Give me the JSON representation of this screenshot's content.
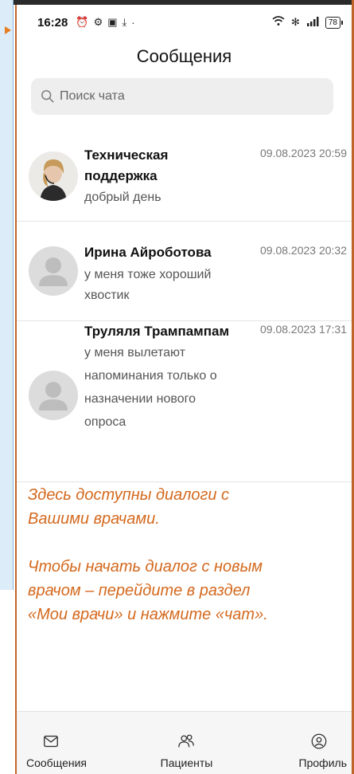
{
  "status_bar": {
    "time": "16:28",
    "battery": "78"
  },
  "header": {
    "title": "Сообщения"
  },
  "search": {
    "placeholder": "Поиск чата"
  },
  "chats": [
    {
      "name_line1": "Техническая",
      "name_line2": "поддержка",
      "time": "09.08.2023 20:59",
      "message": "добрый день"
    },
    {
      "name": "Ирина Айроботова",
      "time": "09.08.2023 20:32",
      "message_line1": "у меня тоже хороший",
      "message_line2": "хвостик"
    },
    {
      "name": "Труляля Трампампам",
      "time": "09.08.2023 17:31",
      "message_line1": "у меня вылетают",
      "message_line2": "напоминания только о",
      "message_line3": "назначении нового",
      "message_line4": "опроса"
    }
  ],
  "note": {
    "line1": "Здесь доступны диалоги с",
    "line2": "Вашими врачами.",
    "line3": "Чтобы начать диалог с новым",
    "line4": "врачом – перейдите в раздел",
    "line5": "«Мои врачи» и нажмите «чат»."
  },
  "tabs": [
    {
      "label": "Сообщения",
      "icon": "mail-icon"
    },
    {
      "label": "Пациенты",
      "icon": "people-icon"
    },
    {
      "label": "Профиль",
      "icon": "profile-icon"
    }
  ],
  "colors": {
    "accent": "#d4691e",
    "slide_panel": "#dcecf9"
  }
}
